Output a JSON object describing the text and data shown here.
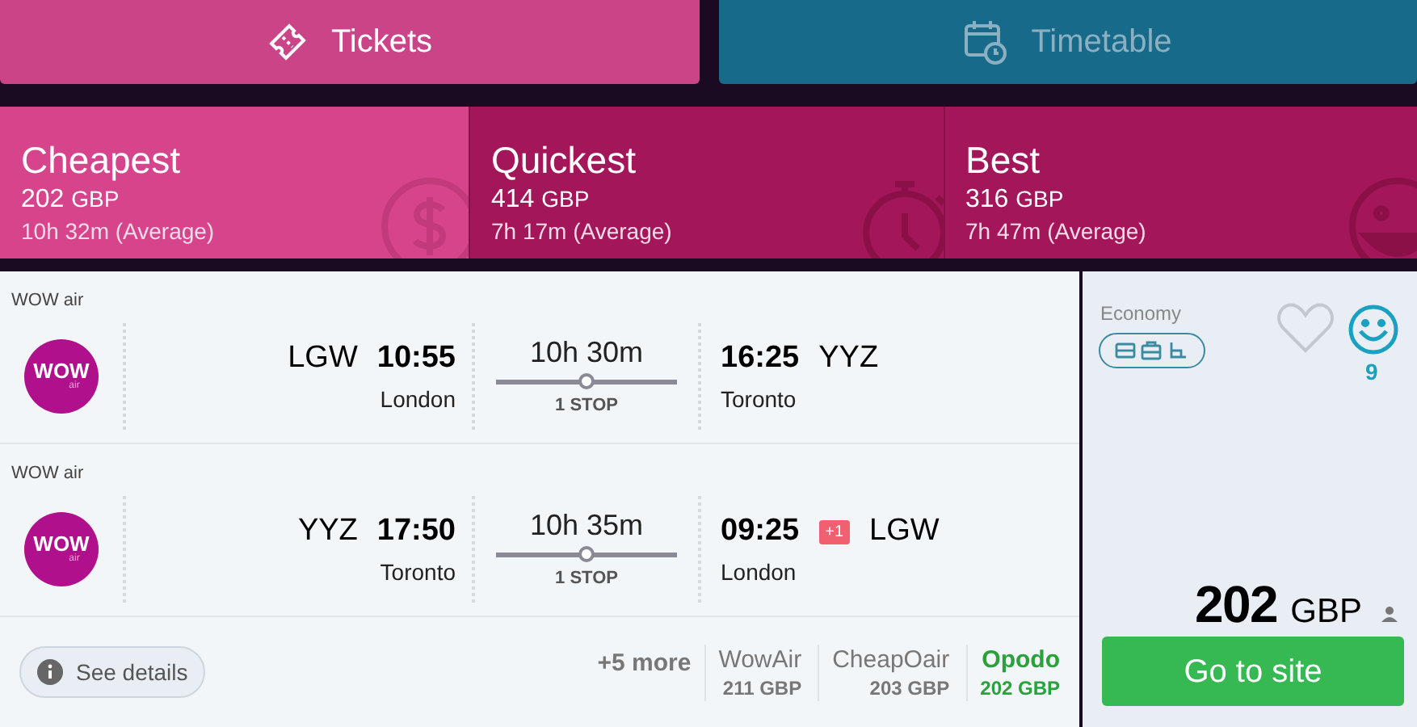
{
  "tabs": [
    {
      "label": "Tickets",
      "kind": "ticket",
      "selected": true
    },
    {
      "label": "Timetable",
      "kind": "calendar",
      "selected": false
    }
  ],
  "sort_options": [
    {
      "label": "Cheapest",
      "price": "202",
      "currency": "GBP",
      "duration": "10h 32m (Average)",
      "kind": "dollar",
      "selected": true
    },
    {
      "label": "Quickest",
      "price": "414",
      "currency": "GBP",
      "duration": "7h 17m (Average)",
      "kind": "stopwatch",
      "selected": false
    },
    {
      "label": "Best",
      "price": "316",
      "currency": "GBP",
      "duration": "7h 47m (Average)",
      "kind": "smiley",
      "selected": false
    }
  ],
  "legs": [
    {
      "airline": "WOW air",
      "logo_text": "WOW",
      "logo_subtext": "air",
      "from_code": "LGW",
      "depart_time": "10:55",
      "from_city": "London",
      "duration": "10h 30m",
      "stops": "1 STOP",
      "arrive_time": "16:25",
      "to_code": "YYZ",
      "to_city": "Toronto"
    },
    {
      "airline": "WOW air",
      "logo_text": "WOW",
      "logo_subtext": "air",
      "from_code": "YYZ",
      "depart_time": "17:50",
      "from_city": "Toronto",
      "duration": "10h 35m",
      "stops": "1 STOP",
      "arrive_time": "09:25",
      "day_offset": "+1",
      "to_code": "LGW",
      "to_city": "London"
    }
  ],
  "details_button": "See details",
  "more_link": "+5 more",
  "providers": [
    {
      "name": "WowAir",
      "price": "211 GBP",
      "highlighted": false
    },
    {
      "name": "CheapOair",
      "price": "203 GBP",
      "highlighted": false
    },
    {
      "name": "Opodo",
      "price": "202 GBP",
      "highlighted": true
    }
  ],
  "cabin": "Economy",
  "favorite": false,
  "rating": "9",
  "price": "202",
  "currency": "GBP",
  "cta": "Go to site"
}
